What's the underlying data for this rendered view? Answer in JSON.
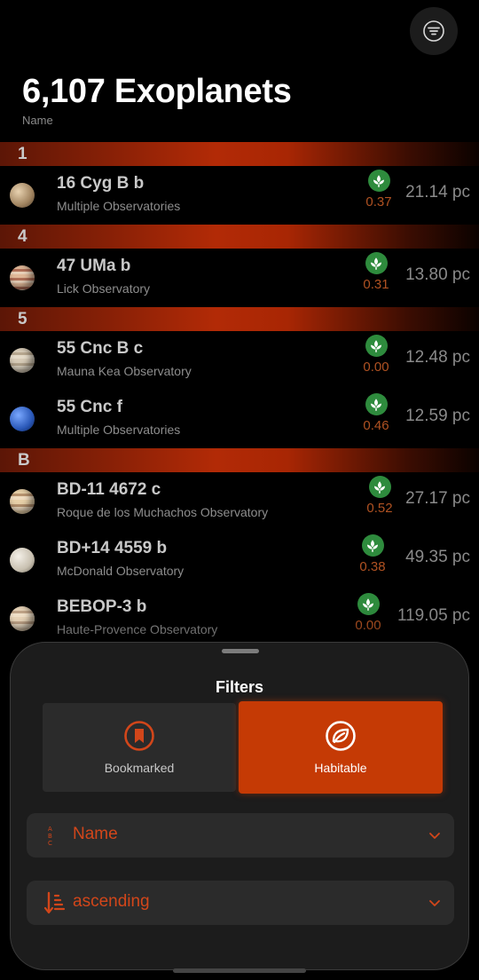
{
  "header": {
    "title": "6,107 Exoplanets",
    "sort_caption": "Name",
    "filter_icon": "filter-lines-icon"
  },
  "colors": {
    "accent": "#c53a05",
    "habitable_green": "#2e8b3d",
    "score_orange": "#b05222"
  },
  "list": [
    {
      "section": "1",
      "rows": [
        {
          "name": "16 Cyg B b",
          "observatory": "Multiple Observatories",
          "score": "0.37",
          "distance": "21.14 pc"
        }
      ]
    },
    {
      "section": "4",
      "rows": [
        {
          "name": "47 UMa b",
          "observatory": "Lick Observatory",
          "score": "0.31",
          "distance": "13.80 pc"
        }
      ]
    },
    {
      "section": "5",
      "rows": [
        {
          "name": "55 Cnc B c",
          "observatory": "Mauna Kea Observatory",
          "score": "0.00",
          "distance": "12.48 pc"
        },
        {
          "name": "55 Cnc f",
          "observatory": "Multiple Observatories",
          "score": "0.46",
          "distance": "12.59 pc"
        }
      ]
    },
    {
      "section": "B",
      "rows": [
        {
          "name": "BD-11 4672 c",
          "observatory": "Roque de los Muchachos Observatory",
          "score": "0.52",
          "distance": "27.17 pc"
        },
        {
          "name": "BD+14 4559 b",
          "observatory": "McDonald Observatory",
          "score": "0.38",
          "distance": "49.35 pc"
        },
        {
          "name": "BEBOP-3 b",
          "observatory": "Haute-Provence Observatory",
          "score": "0.00",
          "distance": "119.05 pc"
        }
      ]
    }
  ],
  "filters_sheet": {
    "title": "Filters",
    "options": [
      {
        "label": "Bookmarked",
        "icon": "bookmark-icon",
        "selected": false
      },
      {
        "label": "Habitable",
        "icon": "leaf-icon",
        "selected": true
      }
    ],
    "sort_field": {
      "value": "Name",
      "icon": "abc-sort-icon"
    },
    "sort_order": {
      "value": "ascending",
      "icon": "sort-ascending-icon"
    }
  }
}
